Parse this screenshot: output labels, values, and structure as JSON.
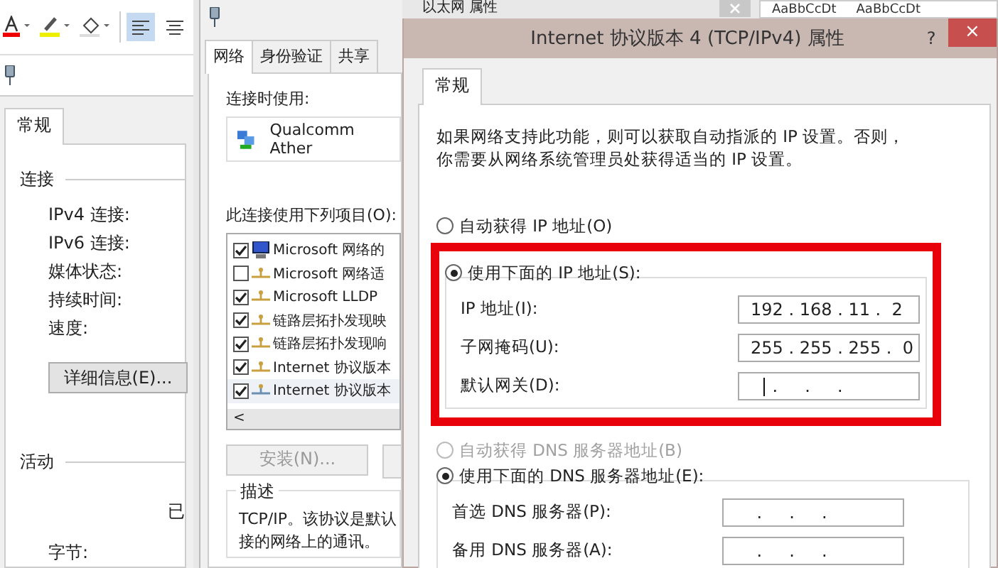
{
  "word_ribbon": {
    "align_buttons": [
      {
        "selected": true
      },
      {
        "selected": false
      }
    ],
    "styles": [
      "AaBbCcDt",
      "AaBbCcDt"
    ]
  },
  "status_window": {
    "tabs": [
      {
        "label": "常规",
        "selected": true
      }
    ],
    "sections": [
      {
        "title": "连接",
        "rows": [
          "IPv4 连接:",
          "IPv6 连接:",
          "媒体状态:",
          "持续时间:",
          "速度:"
        ],
        "button": "详细信息(E)..."
      },
      {
        "title": "活动",
        "cut_text": "已",
        "rows": [
          "字节:"
        ]
      }
    ]
  },
  "ethernet_window": {
    "title": "以太网 属性",
    "tabs": [
      {
        "label": "网络",
        "selected": true
      },
      {
        "label": "身份验证",
        "selected": false
      },
      {
        "label": "共享",
        "selected": false
      }
    ],
    "connect_using_label": "连接时使用:",
    "adapter": "Qualcomm Ather",
    "items_label": "此连接使用下列项目(O):",
    "items": [
      {
        "label": "Microsoft 网络的",
        "checked": true,
        "kind": "client"
      },
      {
        "label": "Microsoft 网络适",
        "checked": false,
        "kind": "protocol"
      },
      {
        "label": "Microsoft LLDP",
        "checked": true,
        "kind": "protocol"
      },
      {
        "label": "链路层拓扑发现映",
        "checked": true,
        "kind": "protocol"
      },
      {
        "label": "链路层拓扑发现响",
        "checked": true,
        "kind": "protocol"
      },
      {
        "label": "Internet 协议版本",
        "checked": true,
        "kind": "protocol"
      },
      {
        "label": "Internet 协议版本",
        "checked": true,
        "kind": "protocol"
      }
    ],
    "scroll_arrow": "<",
    "install_button": {
      "label": "安装(N)...",
      "disabled": true
    },
    "description_title": "描述",
    "description_lines": [
      "TCP/IP。该协议是默认",
      "接的网络上的通讯。"
    ]
  },
  "dialog": {
    "title": "Internet 协议版本 4 (TCP/IPv4) 属性",
    "help": "?",
    "close": "×",
    "tabs": [
      {
        "label": "常规",
        "selected": true
      }
    ],
    "intro": "如果网络支持此功能，则可以获取自动指派的 IP 设置。否则，你需要从网络系统管理员处获得适当的 IP 设置。",
    "ip_mode": [
      {
        "label": "自动获得 IP 地址(O)",
        "selected": false,
        "disabled": false
      },
      {
        "label": "使用下面的 IP 地址(S):",
        "selected": true,
        "disabled": false
      }
    ],
    "ip_fields": [
      {
        "label": "IP 地址(I):",
        "value": "192 . 168 . 11 .  2",
        "cursor": false
      },
      {
        "label": "子网掩码(U):",
        "value": "255 . 255 . 255 .  0",
        "cursor": false
      },
      {
        "label": "默认网关(D):",
        "value": "    .     .     .",
        "cursor": true
      }
    ],
    "highlighted": true,
    "dns_mode": [
      {
        "label": "自动获得 DNS 服务器地址(B)",
        "selected": false,
        "disabled": true
      },
      {
        "label": "使用下面的 DNS 服务器地址(E):",
        "selected": true,
        "disabled": false
      }
    ],
    "dns_fields": [
      {
        "label": "首选 DNS 服务器(P):",
        "value": "    .     .     .",
        "cursor": false
      },
      {
        "label": "备用 DNS 服务器(A):",
        "value": "    .     .     .",
        "cursor": false
      }
    ]
  }
}
